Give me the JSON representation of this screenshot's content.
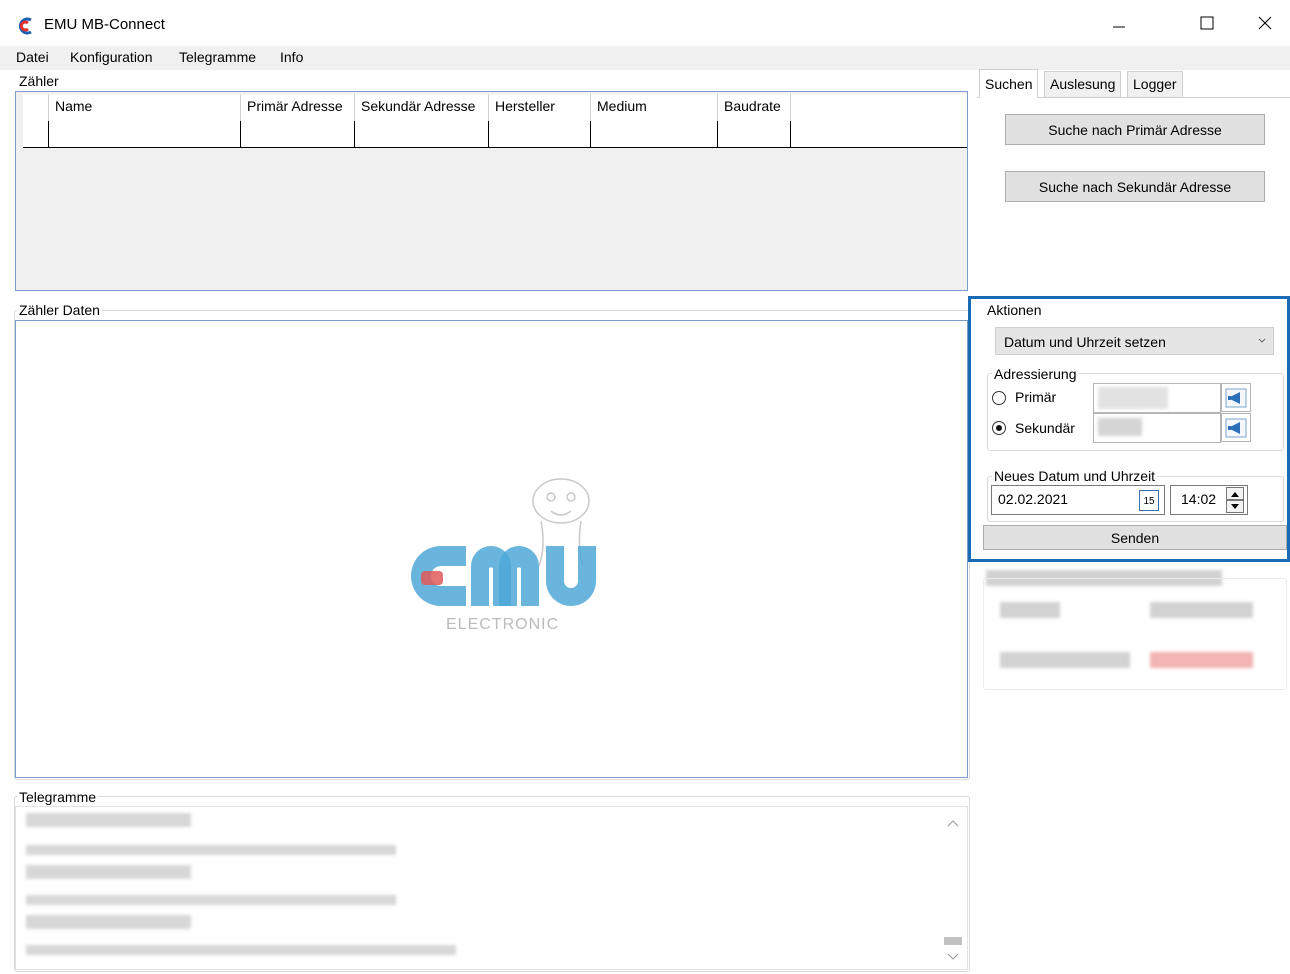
{
  "window": {
    "title": "EMU MB-Connect"
  },
  "menu": [
    "Datei",
    "Konfiguration",
    "Telegramme",
    "Info"
  ],
  "meters_group": {
    "title": "Zähler",
    "columns": [
      "Name",
      "Primär Adresse",
      "Sekundär Adresse",
      "Hersteller",
      "Medium",
      "Baudrate"
    ]
  },
  "data_group": {
    "title": "Zähler Daten",
    "logo": {
      "text": "EMU",
      "subtitle": "ELECTRONIC"
    }
  },
  "telegram_group": {
    "title": "Telegramme"
  },
  "tabs": [
    "Suchen",
    "Auslesung",
    "Logger"
  ],
  "search": {
    "primary_button": "Suche nach Primär Adresse",
    "secondary_button": "Suche nach Sekundär Adresse"
  },
  "actions": {
    "title": "Aktionen",
    "selected_action": "Datum und Uhrzeit setzen",
    "addressing": {
      "title": "Adressierung",
      "primary_label": "Primär",
      "secondary_label": "Sekundär",
      "selected": "Sekundär"
    },
    "datetime": {
      "title": "Neues Datum und Uhrzeit",
      "date": "02.02.2021",
      "calendar_day": "15",
      "time": "14:02"
    },
    "send_button": "Senden"
  },
  "colors": {
    "accent": "#1a6bb5",
    "logo_blue": "#4fa8d8",
    "logo_red": "#e05a5a"
  }
}
